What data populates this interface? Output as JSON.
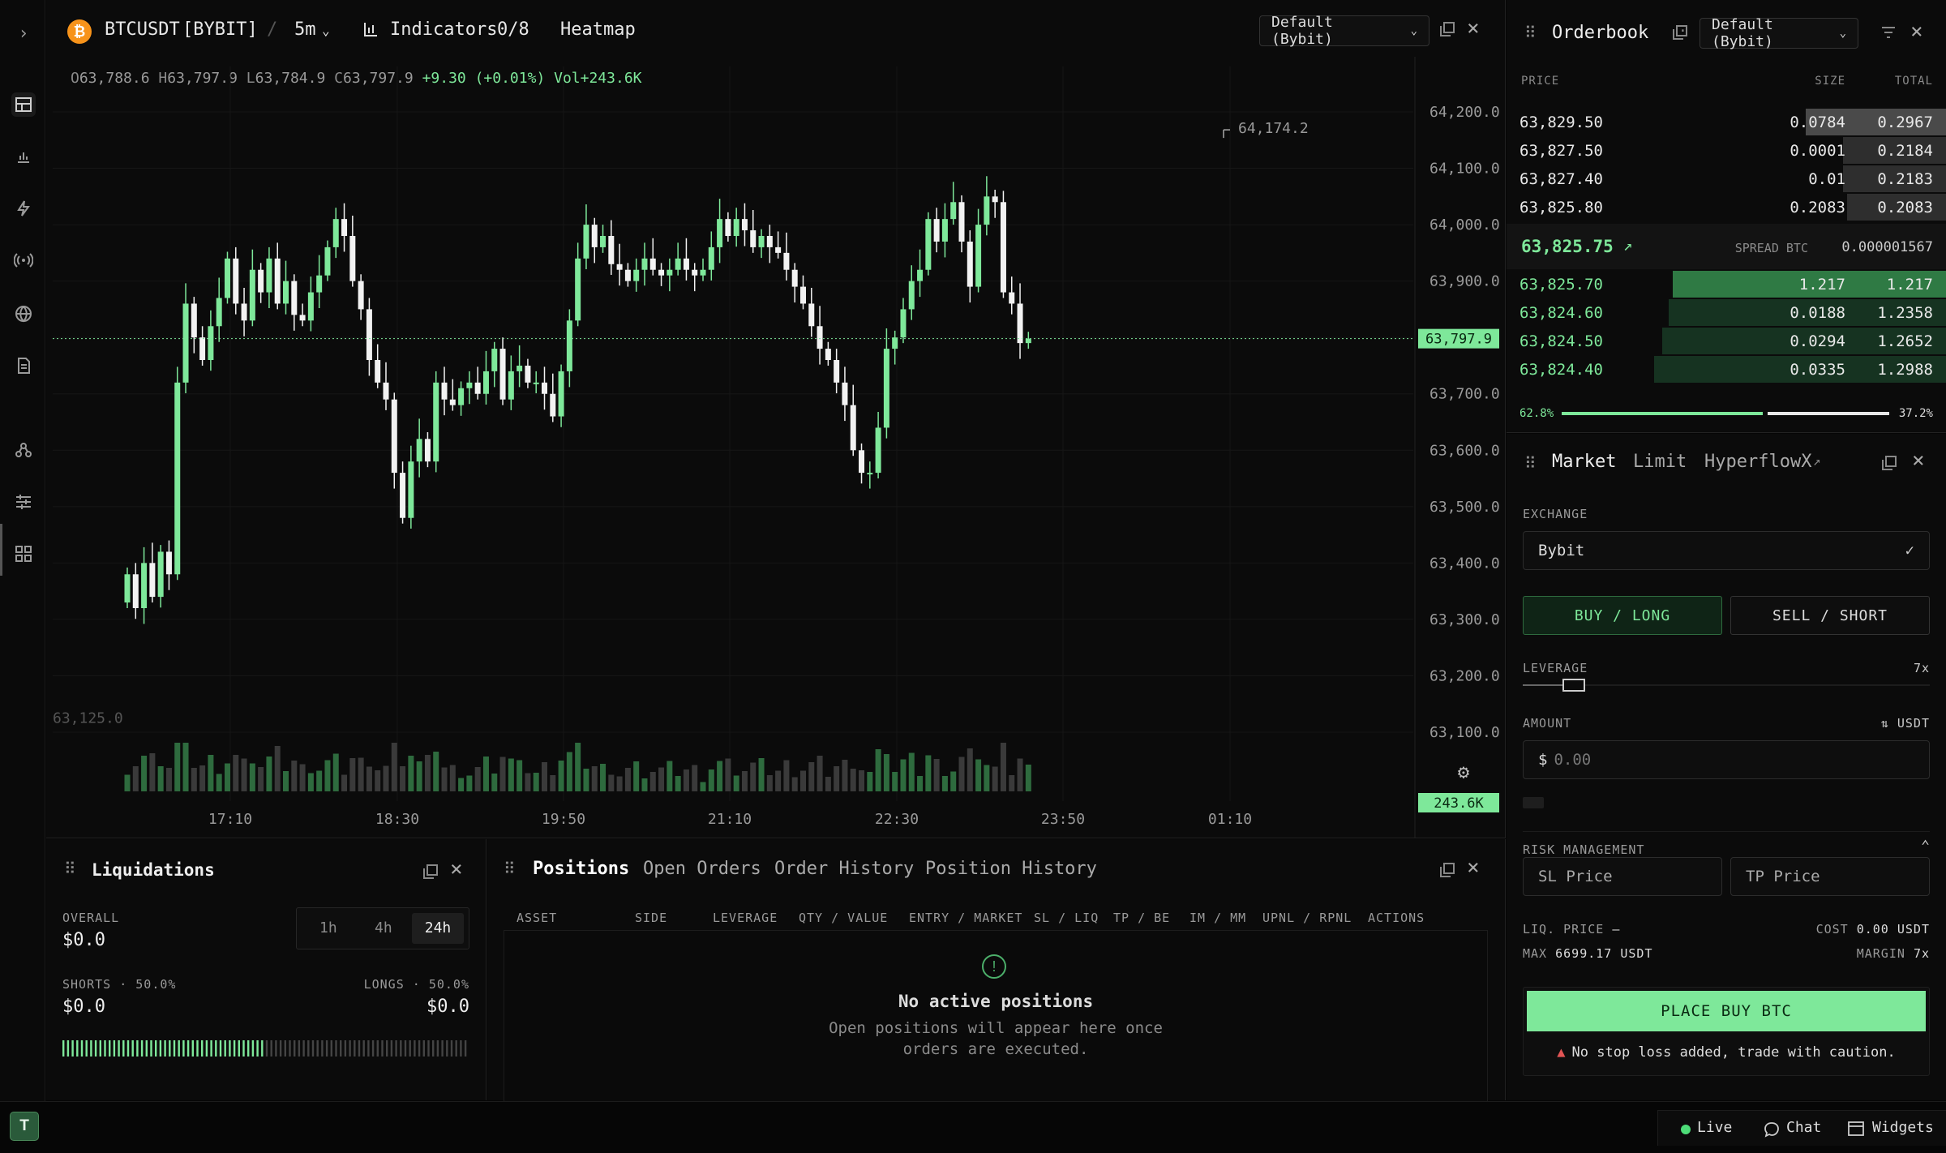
{
  "chart_header": {
    "symbol": "BTCUSDT",
    "exchange": "[BYBIT]",
    "separator": "/",
    "interval": "5m",
    "indicators_label": "Indicators",
    "indicators_count": "0/8",
    "heatmap_label": "Heatmap",
    "layout_select": "Default (Bybit)"
  },
  "ohlc": {
    "o_label": "O",
    "o": "63,788.6",
    "h_label": "H",
    "h": "63,797.9",
    "l_label": "L",
    "l": "63,784.9",
    "c_label": "C",
    "c": "63,797.9",
    "change": "+9.30 (+0.01%)",
    "vol": "Vol+243.6K"
  },
  "chart_data": {
    "type": "candlestick",
    "x_ticks": [
      "17:10",
      "18:30",
      "19:50",
      "21:10",
      "22:30",
      "23:50",
      "01:10"
    ],
    "y_ticks": [
      "64,200.0",
      "64,100.0",
      "64,000.0",
      "63,900.0",
      "63,800.0",
      "63,700.0",
      "63,600.0",
      "63,500.0",
      "63,400.0",
      "63,300.0",
      "63,200.0",
      "63,100.0"
    ],
    "y_ticks_values": [
      64200,
      64100,
      64000,
      63900,
      63800,
      63700,
      63600,
      63500,
      63400,
      63300,
      63200,
      63100
    ],
    "ylim": [
      63050,
      64240
    ],
    "last_price_label": "63,797.9",
    "last_price": 63797.9,
    "volume_label": "243.6K",
    "high_marker_label": "64,174.2",
    "low_marker_label": "63,125.0",
    "up_color": "#7ee89a",
    "down_color": "#f2f2f2",
    "closes": [
      63380,
      63320,
      63400,
      63340,
      63420,
      63380,
      63720,
      63860,
      63800,
      63760,
      63820,
      63870,
      63940,
      63860,
      63830,
      63920,
      63880,
      63940,
      63860,
      63900,
      63840,
      63830,
      63880,
      63910,
      63960,
      64010,
      63980,
      63900,
      63850,
      63760,
      63720,
      63690,
      63560,
      63480,
      63580,
      63620,
      63580,
      63720,
      63690,
      63680,
      63710,
      63720,
      63700,
      63740,
      63780,
      63690,
      63740,
      63750,
      63720,
      63720,
      63700,
      63660,
      63740,
      63830,
      63940,
      64000,
      63960,
      63980,
      63930,
      63920,
      63900,
      63920,
      63940,
      63920,
      63910,
      63920,
      63940,
      63920,
      63910,
      63920,
      63960,
      64010,
      63980,
      64010,
      63990,
      63960,
      63980,
      63960,
      63950,
      63920,
      63890,
      63860,
      63820,
      63780,
      63760,
      63720,
      63680,
      63600,
      63560,
      63560,
      63640,
      63780,
      63800,
      63850,
      63900,
      63920,
      64010,
      63970,
      64010,
      64040,
      63970,
      63890,
      64000,
      64050,
      64040,
      63880,
      63860,
      63790,
      63798
    ]
  },
  "orderbook": {
    "title": "Orderbook",
    "select": "Default (Bybit)",
    "col_price": "PRICE",
    "col_size": "SIZE",
    "col_total": "TOTAL",
    "asks": [
      {
        "price": "63,829.50",
        "size": "0.0784",
        "total": "0.2967",
        "depth": 0.2967
      },
      {
        "price": "63,827.50",
        "size": "0.0001",
        "total": "0.2184",
        "depth": 0.2184
      },
      {
        "price": "63,827.40",
        "size": "0.01",
        "total": "0.2183",
        "depth": 0.2183
      },
      {
        "price": "63,825.80",
        "size": "0.2083",
        "total": "0.2083",
        "depth": 0.2083
      }
    ],
    "mid_price": "63,825.75",
    "mid_arrow": "↗",
    "spread_label": "SPREAD BTC",
    "spread_value": "0.000001567",
    "bids": [
      {
        "price": "63,825.70",
        "size": "1.217",
        "total": "1.217",
        "depth": 1.217
      },
      {
        "price": "63,824.60",
        "size": "0.0188",
        "total": "1.2358",
        "depth": 1.2358
      },
      {
        "price": "63,824.50",
        "size": "0.0294",
        "total": "1.2652",
        "depth": 1.2652
      },
      {
        "price": "63,824.40",
        "size": "0.0335",
        "total": "1.2988",
        "depth": 1.2988
      }
    ],
    "bid_ratio": "62.8%",
    "ask_ratio": "37.2%",
    "bid_ratio_value": 0.628
  },
  "trade": {
    "tabs": [
      "Market",
      "Limit",
      "HyperflowX"
    ],
    "exchange_label": "EXCHANGE",
    "exchange_value": "Bybit",
    "buy_label": "BUY / LONG",
    "sell_label": "SELL / SHORT",
    "leverage_label": "LEVERAGE",
    "leverage_value": "7x",
    "leverage_level": 0.125,
    "amount_label": "AMOUNT",
    "amount_unit": "USDT",
    "amount_prefix": "$",
    "amount_placeholder": "0.00",
    "risk_label": "RISK MANAGEMENT",
    "sl_placeholder": "SL Price",
    "tp_placeholder": "TP Price",
    "liq_label": "LIQ. PRICE",
    "liq_value": "—",
    "cost_label": "COST",
    "cost_value": "0.00 USDT",
    "max_label": "MAX",
    "max_value": "6699.17 USDT",
    "margin_label": "MARGIN",
    "margin_value": "7x",
    "place_button": "PLACE BUY BTC",
    "warning": "No stop loss added, trade with caution."
  },
  "liquidations": {
    "title": "Liquidations",
    "overall_label": "OVERALL",
    "overall_value": "$0.0",
    "ranges": [
      "1h",
      "4h",
      "24h"
    ],
    "active_range": "24h",
    "shorts_label": "SHORTS · 50.0%",
    "shorts_value": "$0.0",
    "longs_label": "LONGS · 50.0%",
    "longs_value": "$0.0",
    "shorts_share": 0.5
  },
  "positions": {
    "tabs": [
      "Positions",
      "Open Orders",
      "Order History",
      "Position History"
    ],
    "columns": [
      "ASSET",
      "SIDE",
      "LEVERAGE",
      "QTY / VALUE",
      "ENTRY / MARKET",
      "SL / LIQ",
      "TP / BE",
      "IM / MM",
      "UPNL / RPNL",
      "ACTIONS"
    ],
    "empty_title": "No active positions",
    "empty_line1": "Open positions will appear here once",
    "empty_line2": "orders are executed."
  },
  "statusbar": {
    "avatar": "T",
    "live": "Live",
    "chat": "Chat",
    "widgets": "Widgets"
  },
  "colors": {
    "accent_green": "#7ee89a",
    "bg": "#0b0b0b",
    "down": "#f2f2f2",
    "warning_red": "#e25555"
  }
}
